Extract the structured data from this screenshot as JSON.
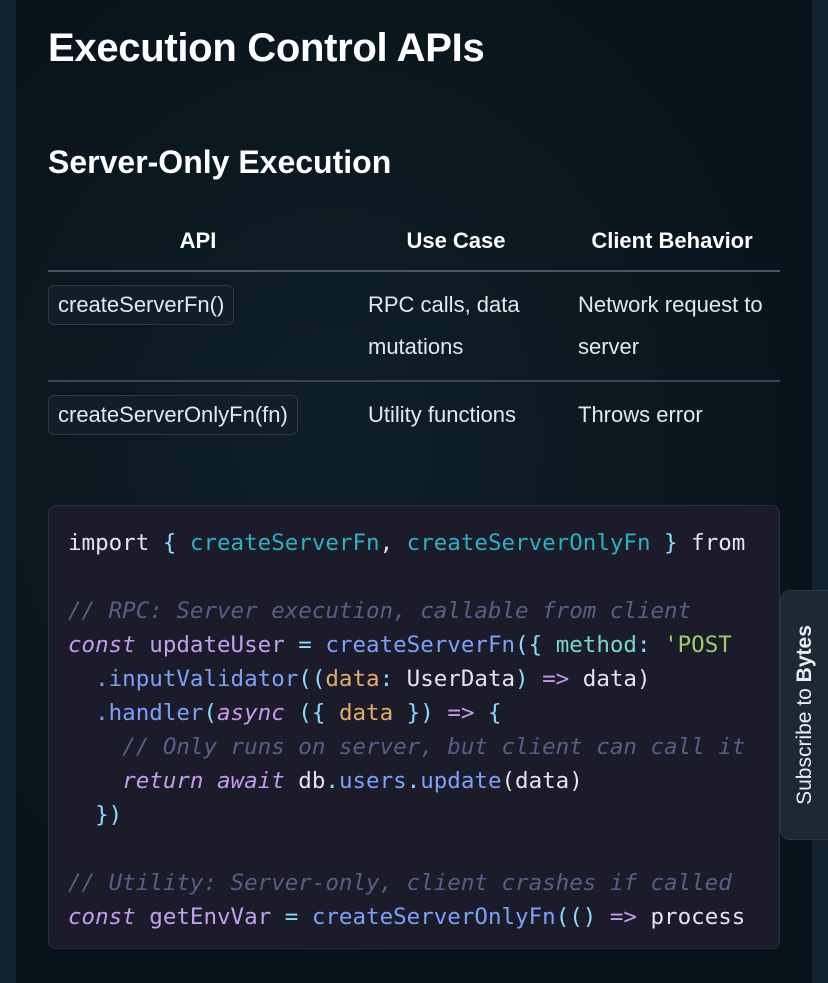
{
  "title": "Execution Control APIs",
  "section": "Server-Only Execution",
  "table": {
    "headers": [
      "API",
      "Use Case",
      "Client Behavior"
    ],
    "rows": [
      {
        "api": "createServerFn()",
        "use_case": "RPC calls, data mutations",
        "client_behavior": "Network request to server"
      },
      {
        "api": "createServerOnlyFn(fn)",
        "use_case": "Utility functions",
        "client_behavior": "Throws error"
      }
    ]
  },
  "code_lines": [
    [
      [
        "pl",
        "import "
      ],
      [
        "op",
        "{ "
      ],
      [
        "im",
        "createServerFn"
      ],
      [
        "pl",
        ", "
      ],
      [
        "im",
        "createServerOnlyFn"
      ],
      [
        "op",
        " }"
      ],
      [
        "pl",
        " from"
      ]
    ],
    [],
    [
      [
        "cm",
        "// RPC: Server execution, callable from client"
      ]
    ],
    [
      [
        "kw",
        "const"
      ],
      [
        "var",
        " updateUser"
      ],
      [
        "op",
        " = "
      ],
      [
        "fn",
        "createServerFn"
      ],
      [
        "op",
        "({ "
      ],
      [
        "key",
        "method"
      ],
      [
        "op",
        ": "
      ],
      [
        "str",
        "'POST"
      ]
    ],
    [
      [
        "pl",
        "  "
      ],
      [
        "fn",
        ".inputValidator"
      ],
      [
        "op",
        "(("
      ],
      [
        "pr",
        "data"
      ],
      [
        "op",
        ": "
      ],
      [
        "pl",
        "UserData"
      ],
      [
        "op",
        ") "
      ],
      [
        "kwn",
        "=>"
      ],
      [
        "pl",
        " data)"
      ]
    ],
    [
      [
        "pl",
        "  "
      ],
      [
        "fn",
        ".handler"
      ],
      [
        "op",
        "("
      ],
      [
        "kw",
        "async"
      ],
      [
        "op",
        " ({ "
      ],
      [
        "pr",
        "data"
      ],
      [
        "op",
        " }) "
      ],
      [
        "kwn",
        "=>"
      ],
      [
        "op",
        " {"
      ]
    ],
    [
      [
        "pl",
        "    "
      ],
      [
        "cm",
        "// Only runs on server, but client can call it"
      ]
    ],
    [
      [
        "pl",
        "    "
      ],
      [
        "kw",
        "return"
      ],
      [
        "kw",
        " await"
      ],
      [
        "pl",
        " db"
      ],
      [
        "op",
        "."
      ],
      [
        "fn",
        "users"
      ],
      [
        "op",
        "."
      ],
      [
        "fn",
        "update"
      ],
      [
        "pl",
        "(data)"
      ]
    ],
    [
      [
        "op",
        "  })"
      ]
    ],
    [],
    [
      [
        "cm",
        "// Utility: Server-only, client crashes if called"
      ]
    ],
    [
      [
        "kw",
        "const"
      ],
      [
        "var",
        " getEnvVar"
      ],
      [
        "op",
        " = "
      ],
      [
        "fn",
        "createServerOnlyFn"
      ],
      [
        "op",
        "(() "
      ],
      [
        "kwn",
        "=>"
      ],
      [
        "pl",
        " process"
      ]
    ]
  ],
  "subscribe": {
    "prefix": "Subscribe to ",
    "brand": "Bytes"
  }
}
